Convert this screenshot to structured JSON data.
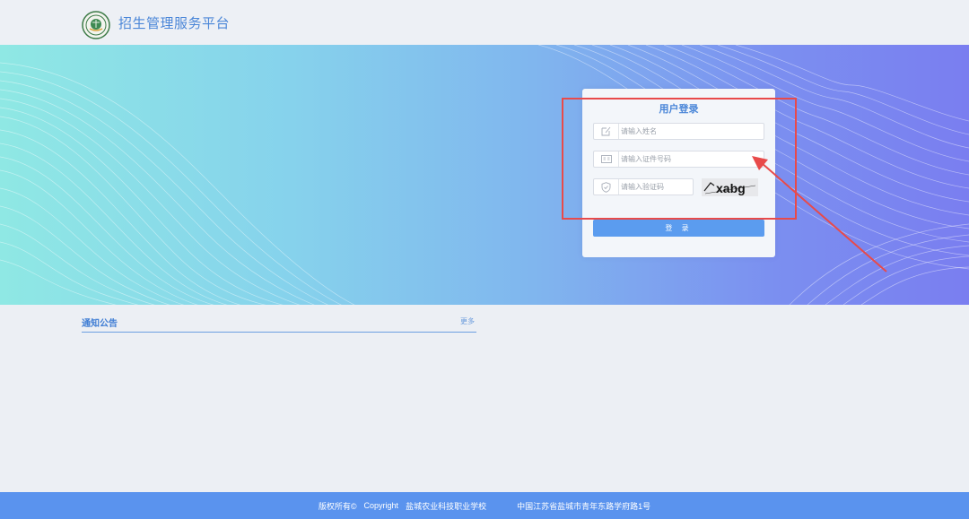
{
  "header": {
    "logo_icon": "school-seal-icon",
    "site_title": "招生管理服务平台"
  },
  "login": {
    "title": "用户登录",
    "name_placeholder": "请输入姓名",
    "name_icon": "edit-icon",
    "id_placeholder": "请输入证件号码",
    "id_icon": "id-card-icon",
    "captcha_placeholder": "请输入验证码",
    "captcha_icon": "shield-icon",
    "captcha_text": "xabg",
    "login_button": "登 录"
  },
  "notice": {
    "title": "通知公告",
    "more": "更多"
  },
  "footer": {
    "copyright": "版权所有©",
    "copyright_word": "Copyright",
    "school": "盐城农业科技职业学校",
    "address": "中国江苏省盐城市青年东路学府路1号"
  },
  "colors": {
    "accent": "#4a86d8",
    "footer_bg": "#5a93ee",
    "annotation_red": "#e84a4a"
  }
}
